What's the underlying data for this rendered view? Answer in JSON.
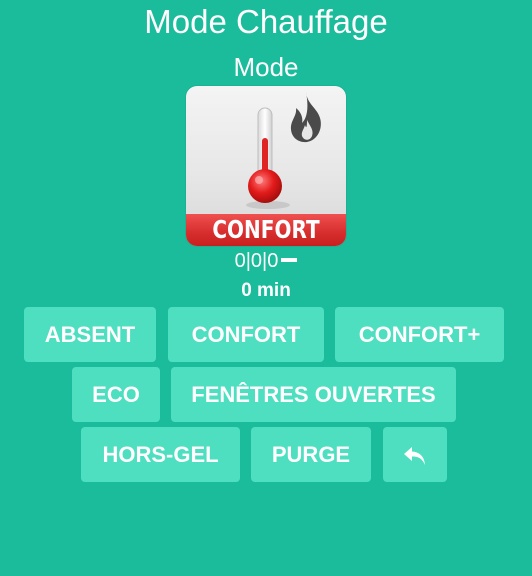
{
  "page": {
    "title": "Mode Chauffage",
    "subtitle": "Mode"
  },
  "mode_image": {
    "icon": "thermometer-flame-icon",
    "banner_label": "CONFORT",
    "banner_color": "#d62d2d",
    "thermometer_color": "#e02424"
  },
  "status": {
    "counters": "0|0|0",
    "duration": "0 min"
  },
  "buttons": {
    "absent": "ABSENT",
    "confort": "CONFORT",
    "confort_plus": "CONFORT+",
    "eco": "ECO",
    "fenetres_ouvertes": "FENÊTRES OUVERTES",
    "hors_gel": "HORS-GEL",
    "purge": "PURGE",
    "back_icon": "undo-arrow-icon"
  },
  "colors": {
    "background": "#1bbc9b",
    "button": "#4ddfc0"
  }
}
